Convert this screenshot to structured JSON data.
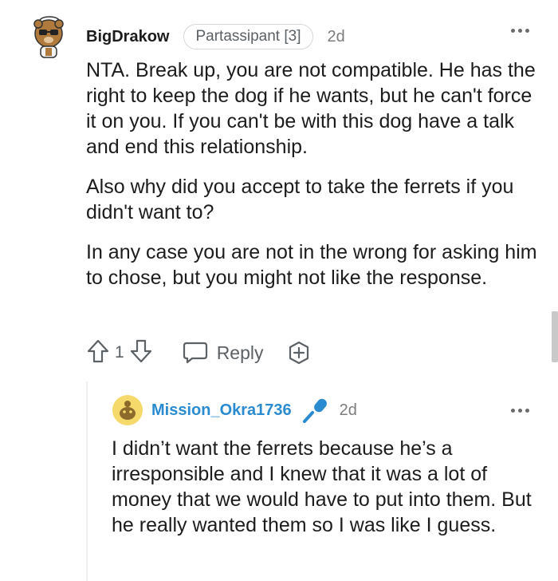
{
  "comment": {
    "username": "BigDrakow",
    "flair": "Partassipant [3]",
    "time": "2d",
    "paragraphs": [
      "NTA. Break up, you are not compatible. He has the right to keep the dog if he wants, but he can't force it on you. If you can't be with this dog have a talk and end this relationship.",
      "Also why did you accept to take the ferrets if you didn't want to?",
      "In any case you are not in the wrong for asking him to chose, but you might not like the response."
    ],
    "actions": {
      "vote_count": "1",
      "reply_label": "Reply"
    }
  },
  "reply": {
    "username": "Mission_Okra1736",
    "time": "2d",
    "text": "I didn’t want the ferrets because he’s a irresponsible and I knew that it was a lot of money that we would have to put into them. But he really wanted them so I was like I guess."
  },
  "icons": {
    "avatar_main": "snoo-bear-avatar",
    "avatar_reply": "snoo-yellow-avatar",
    "upvote": "upvote-arrow-icon",
    "downvote": "downvote-arrow-icon",
    "reply": "speech-bubble-icon",
    "award": "award-plus-icon",
    "mic": "microphone-icon",
    "more": "more-dots-icon"
  },
  "colors": {
    "reply_username": "#2a8bd0",
    "mic": "#2a8bd0",
    "reply_avatar_bg": "#f5d96a"
  }
}
